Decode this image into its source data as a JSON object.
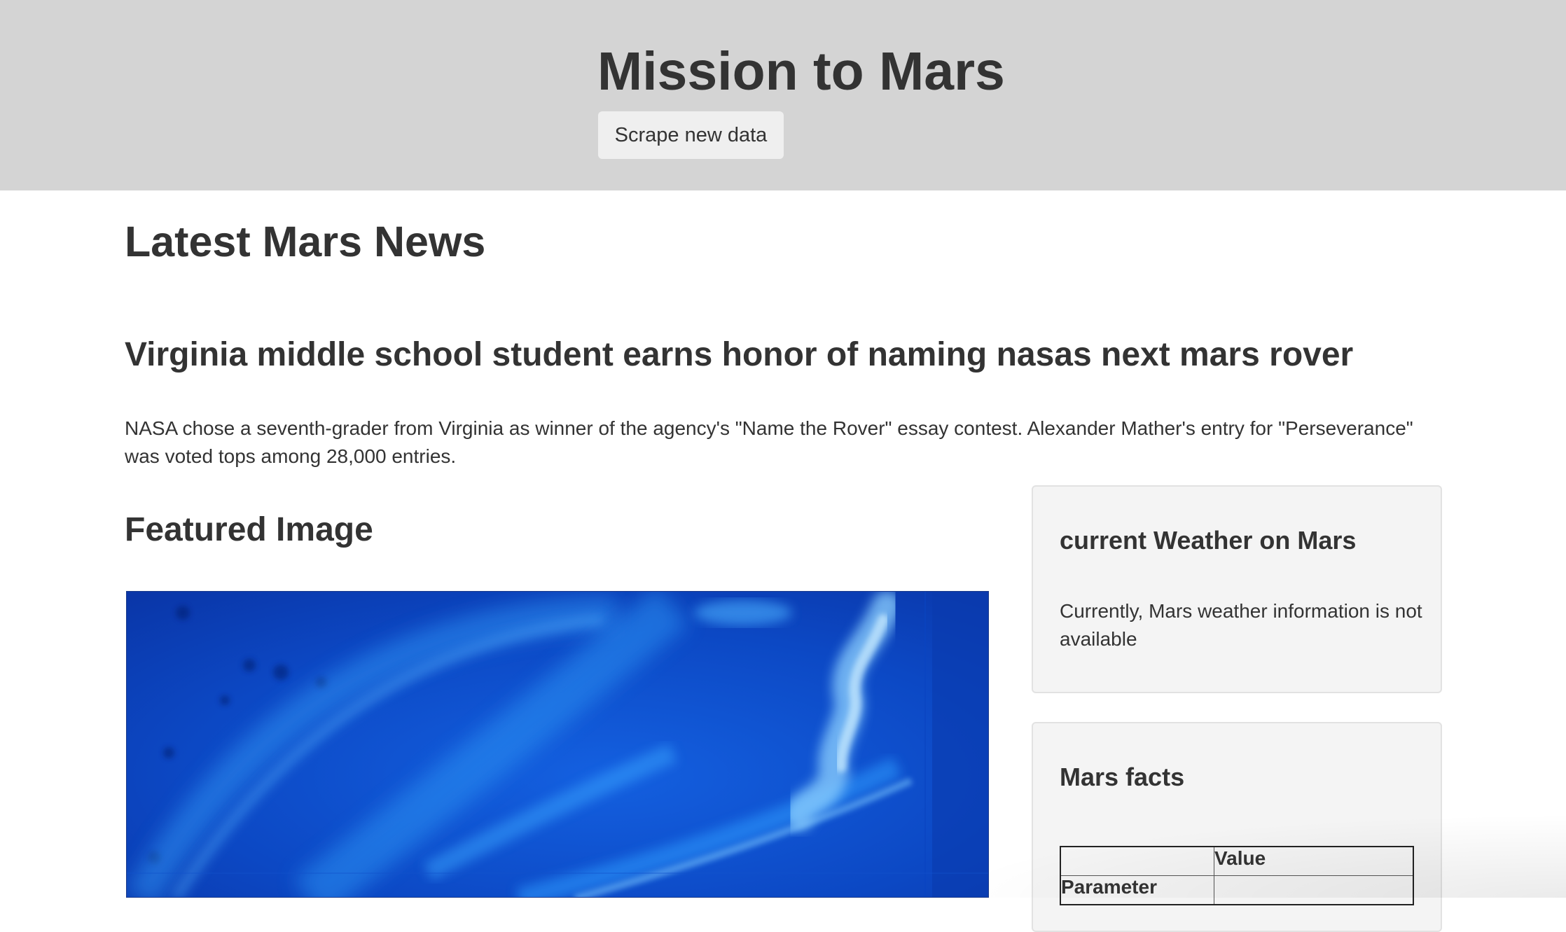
{
  "header": {
    "title": "Mission to Mars",
    "scrape_button_label": "Scrape new data"
  },
  "news": {
    "section_title": "Latest Mars News",
    "title": "Virginia middle school student earns honor of naming nasas next mars rover",
    "paragraph": "NASA chose a seventh-grader from Virginia as winner of the agency's \"Name the Rover\" essay contest. Alexander Mather's entry for \"Perseverance\" was voted tops among 28,000 entries."
  },
  "featured_image": {
    "section_title": "Featured Image",
    "colors": {
      "background": "#0a3fb8",
      "glow": "#2ea0ff",
      "highlight": "#b8e4ff"
    }
  },
  "weather": {
    "title": "current Weather on Mars",
    "text": "Currently, Mars weather information is not available"
  },
  "facts": {
    "title": "Mars facts",
    "table": {
      "header_row": [
        "",
        "Value"
      ],
      "index_label": "Parameter"
    }
  },
  "colors": {
    "jumbotron_bg": "#d4d4d4",
    "text": "#333333",
    "card_bg": "#f4f4f4",
    "button_bg": "#efefef"
  }
}
